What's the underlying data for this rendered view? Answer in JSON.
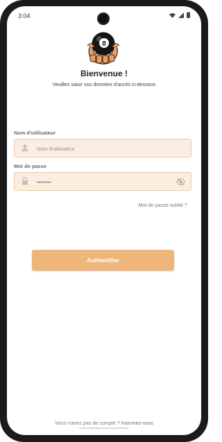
{
  "status_bar": {
    "time": "3:04",
    "icons": [
      "wifi-icon",
      "signal-icon",
      "battery-icon"
    ]
  },
  "logo": {
    "icon": "eight-ball-logo-icon"
  },
  "header": {
    "title": "Bienvenue !",
    "subtitle": "Veuillez saisir vos données d'accès ci-dessous"
  },
  "form": {
    "username": {
      "label": "Nom d'utilisateur",
      "placeholder": "Nom d'utilisateur",
      "value": "",
      "icon": "user-icon"
    },
    "password": {
      "label": "Mot de passe",
      "value": "••••••••",
      "icon": "lock-icon",
      "toggle_icon": "eye-off-icon"
    },
    "forgot_password": "Mot de passe oublié ?",
    "submit_label": "Authentifier"
  },
  "footer": {
    "signup_prompt": "Vous n'avez pas de compte ?",
    "signup_link": "Inscrivez-vous"
  },
  "colors": {
    "accent": "#efb67b",
    "field_background": "#fbeee1",
    "field_border": "#e8c9a5"
  }
}
